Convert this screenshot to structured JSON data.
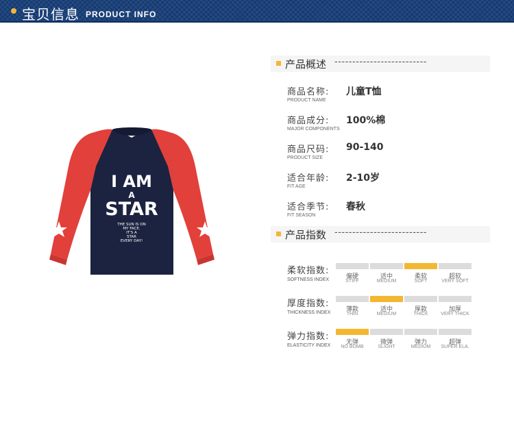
{
  "header": {
    "title_cn": "宝贝信息",
    "title_en": "PRODUCT INFO"
  },
  "product_image": {
    "print_line1": "I AM",
    "print_line2": "A",
    "print_line3": "STAR",
    "print_small": [
      "THE SUN IS ON",
      "MY FACE.",
      "IT'S A",
      "STAR",
      "EVERY DAY!"
    ],
    "colors": {
      "body": "#1b2340",
      "sleeve": "#e2403a",
      "text": "#ffffff"
    }
  },
  "overview": {
    "title": "产品概述",
    "dashes": "--------------------------",
    "rows": [
      {
        "label": "商品名称:",
        "label_en": "PRODUCT NAME",
        "value": "儿童T恤"
      },
      {
        "label": "商品成分:",
        "label_en": "MAJOR COMPONENTS",
        "value": "100%棉"
      },
      {
        "label": "商品尺码:",
        "label_en": "PRODUCT SIZE",
        "value": "90-140"
      },
      {
        "label": "适合年龄:",
        "label_en": "FIT AGE",
        "value": "2-10岁"
      },
      {
        "label": "适合季节:",
        "label_en": "FIT SEASON",
        "value": "春秋"
      }
    ]
  },
  "indices": {
    "title": "产品指数",
    "dashes": "--------------------------",
    "rows": [
      {
        "label": "柔软指数:",
        "label_en": "SOFTNESS INDEX",
        "selected": 2,
        "options": [
          {
            "cn": "偏硬",
            "en": "STIFF"
          },
          {
            "cn": "适中",
            "en": "MEDIUM"
          },
          {
            "cn": "柔软",
            "en": "SOFT"
          },
          {
            "cn": "超软",
            "en": "VERY SOFT"
          }
        ]
      },
      {
        "label": "厚度指数:",
        "label_en": "THICKNESS INDEX",
        "selected": 1,
        "options": [
          {
            "cn": "薄款",
            "en": "THIN"
          },
          {
            "cn": "适中",
            "en": "MEDIUM"
          },
          {
            "cn": "厚款",
            "en": "THICK"
          },
          {
            "cn": "加厚",
            "en": "VERY THICK"
          }
        ]
      },
      {
        "label": "弹力指数:",
        "label_en": "ELASTICITY INDEX",
        "selected": 0,
        "options": [
          {
            "cn": "无弹",
            "en": "NO BOMB"
          },
          {
            "cn": "微弹",
            "en": "SLIGHT"
          },
          {
            "cn": "弹力",
            "en": "MEDIUM"
          },
          {
            "cn": "超弹",
            "en": "SUPER ELA."
          }
        ]
      }
    ]
  },
  "accent_color": "#f4b731",
  "banner_color": "#143a73"
}
